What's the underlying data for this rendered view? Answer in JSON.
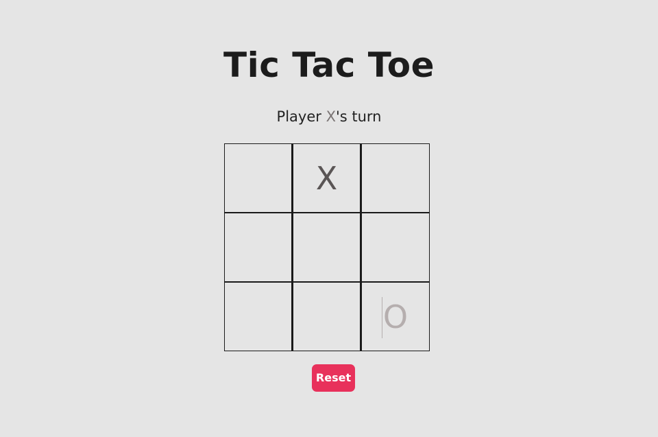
{
  "title": "Tic Tac Toe",
  "status": {
    "prefix": "Player ",
    "player": "X",
    "suffix": "'s turn"
  },
  "board": {
    "cells": [
      "",
      "X",
      "",
      "",
      "",
      "",
      "",
      "",
      "O"
    ]
  },
  "reset_label": "Reset",
  "colors": {
    "background": "#e5e5e5",
    "x_mark": "#5a5555",
    "o_mark": "#b5aeae",
    "reset_button": "#e8315b"
  }
}
